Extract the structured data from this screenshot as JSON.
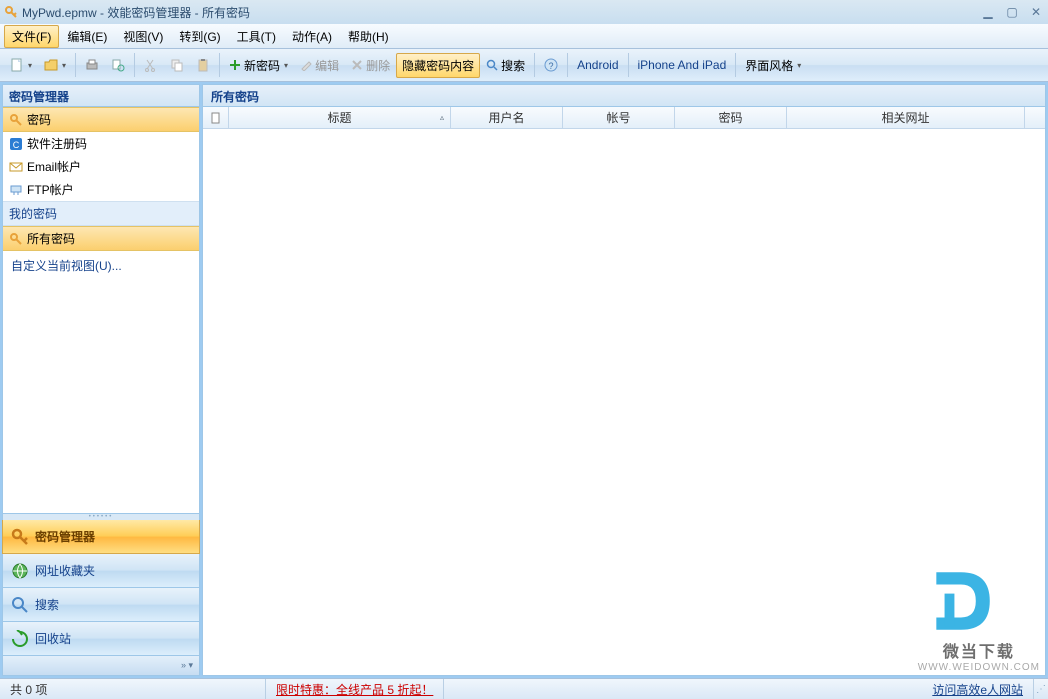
{
  "window": {
    "title": "MyPwd.epmw - 效能密码管理器 - 所有密码"
  },
  "menus": {
    "file": "文件(F)",
    "edit": "编辑(E)",
    "view": "视图(V)",
    "goto": "转到(G)",
    "tools": "工具(T)",
    "action": "动作(A)",
    "help": "帮助(H)"
  },
  "toolbar": {
    "new_password": "新密码",
    "edit": "编辑",
    "delete": "删除",
    "hide_content": "隐藏密码内容",
    "search": "搜索",
    "android": "Android",
    "iphone": "iPhone And iPad",
    "style": "界面风格"
  },
  "sidebar": {
    "header": "密码管理器",
    "items": [
      {
        "label": "密码"
      },
      {
        "label": "软件注册码"
      },
      {
        "label": "Email帐户"
      },
      {
        "label": "FTP帐户"
      }
    ],
    "my_header": "我的密码",
    "all_passwords": "所有密码",
    "customize": "自定义当前视图(U)..."
  },
  "nav": {
    "password_manager": "密码管理器",
    "favorites": "网址收藏夹",
    "search": "搜索",
    "recycle": "回收站"
  },
  "content": {
    "title": "所有密码",
    "columns": {
      "icon": "",
      "title": "标题",
      "user": "用户名",
      "account": "帐号",
      "password": "密码",
      "url": "相关网址"
    }
  },
  "status": {
    "count_label": "共 0 项",
    "promo": "限时特惠：全线产品 5 折起！",
    "site_link": "访问高效e人网站"
  },
  "watermark": {
    "t1": "微当下载",
    "t2": "WWW.WEIDOWN.COM"
  }
}
